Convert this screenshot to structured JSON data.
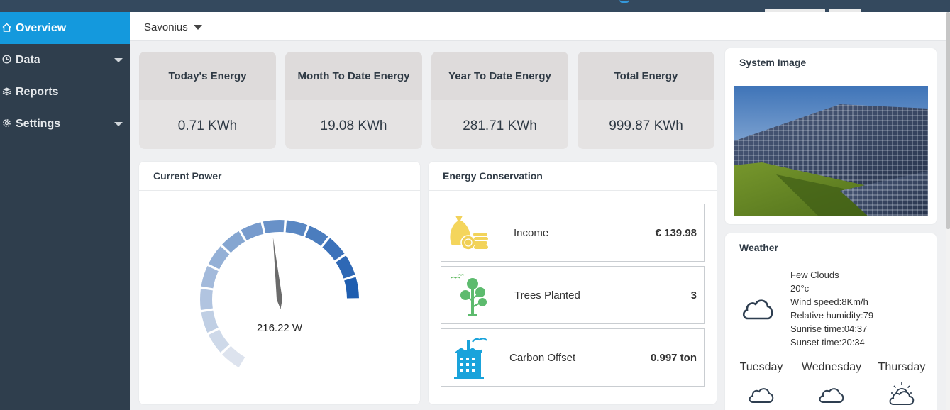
{
  "colors": {
    "sidebar_bg": "#2f3e4d",
    "active_accent": "#1499dd",
    "topbar_bg": "#34495e",
    "gauge_dark": "#2060b0",
    "gauge_light": "#dde3ee"
  },
  "sidebar": {
    "items": [
      {
        "label": "Overview",
        "icon": "home-icon",
        "active": true
      },
      {
        "label": "Data",
        "icon": "clock-icon",
        "has_caret": true
      },
      {
        "label": "Reports",
        "icon": "layers-icon"
      },
      {
        "label": "Settings",
        "icon": "gear-icon",
        "has_caret": true
      }
    ]
  },
  "header": {
    "site_selected": "Savonius"
  },
  "stats": [
    {
      "label": "Today's Energy",
      "value": "0.71 KWh"
    },
    {
      "label": "Month To Date Energy",
      "value": "19.08 KWh"
    },
    {
      "label": "Year To Date Energy",
      "value": "281.71 KWh"
    },
    {
      "label": "Total Energy",
      "value": "999.87 KWh"
    }
  ],
  "current_power": {
    "title": "Current Power",
    "value_text": "216.22 W",
    "needle_fraction": 0.6
  },
  "energy_conservation": {
    "title": "Energy Conservation",
    "rows": [
      {
        "icon": "money-bag-icon",
        "label": "Income",
        "value": "€ 139.98"
      },
      {
        "icon": "trees-icon",
        "label": "Trees Planted",
        "value": "3"
      },
      {
        "icon": "factory-icon",
        "label": "Carbon Offset",
        "value": "0.997 ton"
      }
    ]
  },
  "system_image": {
    "title": "System Image"
  },
  "weather": {
    "title": "Weather",
    "condition": "Few Clouds",
    "temperature": "20°c",
    "wind": "Wind speed:8Km/h",
    "humidity": "Relative humidity:79",
    "sunrise": "Sunrise time:04:37",
    "sunset": "Sunset time:20:34",
    "forecast": [
      {
        "day": "Tuesday",
        "icon": "cloud-icon"
      },
      {
        "day": "Wednesday",
        "icon": "cloud-icon"
      },
      {
        "day": "Thursday",
        "icon": "partly-sunny-icon"
      }
    ]
  }
}
